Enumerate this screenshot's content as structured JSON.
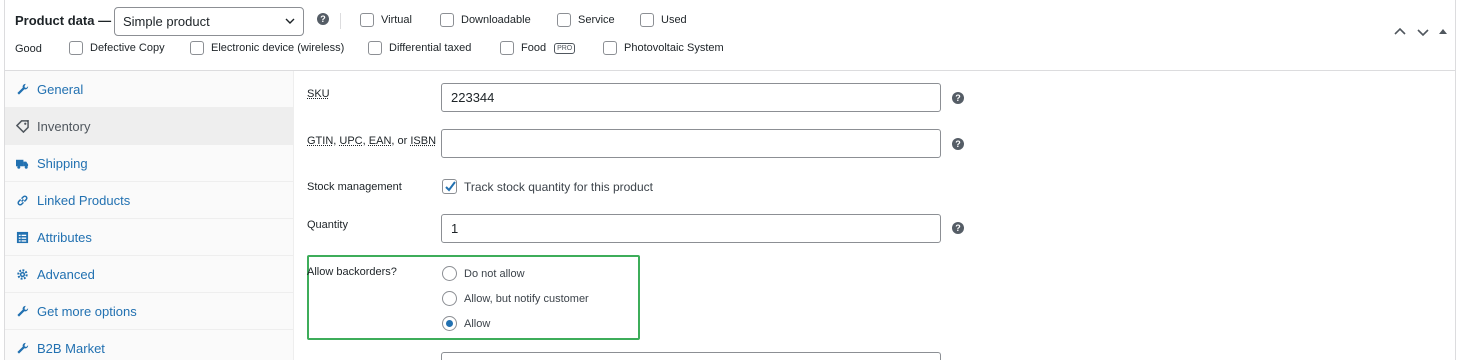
{
  "header": {
    "title": "Product data —",
    "product_type": "Simple product",
    "options_row1": [
      {
        "label": "Virtual"
      },
      {
        "label": "Downloadable"
      },
      {
        "label": "Service"
      },
      {
        "label": "Used"
      }
    ],
    "row2_prefix": "Good",
    "options_row2": [
      {
        "label": "Defective Copy"
      },
      {
        "label": "Electronic device (wireless)"
      },
      {
        "label": "Differential taxed"
      },
      {
        "label": "Food",
        "badge": "PRO"
      },
      {
        "label": "Photovoltaic System"
      }
    ],
    "help_glyph": "?",
    "controls": [
      "chevron-up-icon",
      "chevron-down-icon",
      "triangle-up-icon"
    ]
  },
  "tabs": [
    {
      "label": "General",
      "icon": "wrench-icon",
      "active": false
    },
    {
      "label": "Inventory",
      "icon": "tag-icon",
      "active": true
    },
    {
      "label": "Shipping",
      "icon": "truck-icon",
      "active": false
    },
    {
      "label": "Linked Products",
      "icon": "link-icon",
      "active": false
    },
    {
      "label": "Attributes",
      "icon": "list-icon",
      "active": false
    },
    {
      "label": "Advanced",
      "icon": "gear-icon",
      "active": false
    },
    {
      "label": "Get more options",
      "icon": "wrench-icon",
      "active": false
    },
    {
      "label": "B2B Market",
      "icon": "wrench-icon",
      "active": false
    }
  ],
  "inventory": {
    "sku_label": "SKU",
    "sku_value": "223344",
    "gtin_label_parts": [
      "GTIN",
      "UPC",
      "EAN",
      "ISBN"
    ],
    "gtin_value": "",
    "stock_label": "Stock management",
    "stock_checkbox_label": "Track stock quantity for this product",
    "stock_checked": true,
    "quantity_label": "Quantity",
    "quantity_value": "1",
    "backorders_label": "Allow backorders?",
    "backorder_options": [
      {
        "label": "Do not allow",
        "selected": false
      },
      {
        "label": "Allow, but notify customer",
        "selected": false
      },
      {
        "label": "Allow",
        "selected": true
      }
    ],
    "highlight_color": "#3dad5a",
    "accent_color": "#2271b1"
  }
}
